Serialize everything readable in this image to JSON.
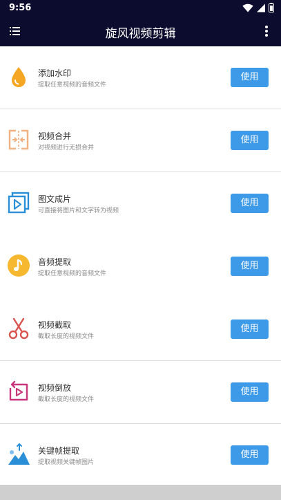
{
  "status_bar": {
    "time": "9:56",
    "icons": [
      "wifi-icon",
      "signal-icon",
      "battery-icon"
    ]
  },
  "app_bar": {
    "title": "旋风视频剪辑",
    "background": "#0b0c2e",
    "menu_icon": "list-menu-icon",
    "more_icon": "more-vertical-icon"
  },
  "accent_color": "#3d9ae8",
  "features": [
    {
      "title": "添加水印",
      "subtitle": "提取任意视频的音频文件",
      "button": "使用",
      "icon": "water-drop-icon",
      "icon_color": "#f5a623"
    },
    {
      "title": "视频合并",
      "subtitle": "对视频进行无损合并",
      "button": "使用",
      "icon": "merge-icon",
      "icon_color": "#f0b080"
    },
    {
      "title": "图文成片",
      "subtitle": "可直接将图片和文字转为视频",
      "button": "使用",
      "icon": "image-to-video-icon",
      "icon_color": "#2a8fd6"
    },
    {
      "title": "音频提取",
      "subtitle": "提取任意视频的音频文件",
      "button": "使用",
      "icon": "music-note-icon",
      "icon_color": "#f5b82e"
    },
    {
      "title": "视频截取",
      "subtitle": "截取长度的视频文件",
      "button": "使用",
      "icon": "scissors-icon",
      "icon_color": "#d9534f"
    },
    {
      "title": "视频倒放",
      "subtitle": "截取长度的视频文件",
      "button": "使用",
      "icon": "reverse-play-icon",
      "icon_color": "#c8357a"
    },
    {
      "title": "关键帧提取",
      "subtitle": "提取视频关键帧图片",
      "button": "使用",
      "icon": "keyframe-icon",
      "icon_color": "#2a8fd6"
    }
  ]
}
